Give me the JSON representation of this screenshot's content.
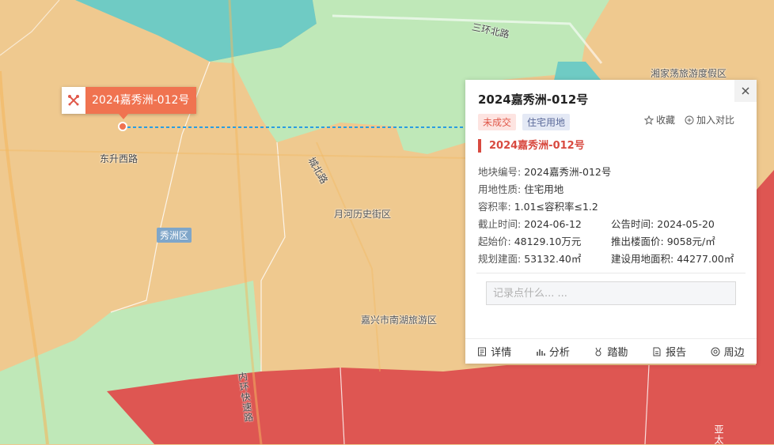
{
  "map": {
    "labels": {
      "road_sanhuan_bei": "三环北路",
      "xiangjiadang": "湘家荡旅游度假区",
      "dongsheng_xi": "东升西路",
      "chengbei": "城北路",
      "yuehe": "月河历史街区",
      "xiuzhou_district": "秀洲区",
      "nanhu": "嘉兴市南湖旅游区",
      "neihuan": "内环快速路",
      "ya": "亚太"
    }
  },
  "marker": {
    "label": "2024嘉秀洲-012号",
    "icon": "crossed-shovels-icon"
  },
  "popup": {
    "title": "2024嘉秀洲-012号",
    "status_tag": "未成交",
    "use_tag": "住宅用地",
    "favorite_label": "收藏",
    "compare_label": "加入对比",
    "section_title": "2024嘉秀洲-012号",
    "fields": {
      "parcel_no_label": "地块编号:",
      "parcel_no": "2024嘉秀洲-012号",
      "land_use_label": "用地性质:",
      "land_use": "住宅用地",
      "far_label": "容积率:",
      "far": "1.01≤容积率≤1.2",
      "deadline_label": "截止时间:",
      "deadline": "2024-06-12",
      "announce_label": "公告时间:",
      "announce": "2024-05-20",
      "start_price_label": "起始价:",
      "start_price": "48129.10万元",
      "floor_price_label": "推出楼面价:",
      "floor_price": "9058元/㎡",
      "plan_area_label": "规划建面:",
      "plan_area": "53132.40㎡",
      "land_area_label": "建设用地面积:",
      "land_area": "44277.00㎡"
    },
    "note_placeholder": "记录点什么... ...",
    "bottom": {
      "detail": "详情",
      "analysis": "分析",
      "survey": "踏勘",
      "report": "报告",
      "nearby": "周边"
    }
  },
  "colors": {
    "orange_zone": "#efc98f",
    "green_zone": "#bfe8b8",
    "teal_zone": "#6fcbc4",
    "red_zone": "#de5652",
    "accent": "#f07350"
  }
}
